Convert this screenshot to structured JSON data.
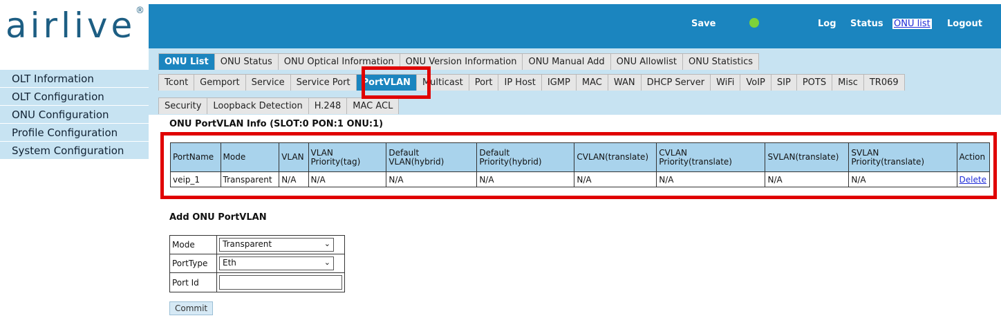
{
  "brand": {
    "logo_text": "airlive",
    "logo_mark": "®"
  },
  "header": {
    "save": "Save",
    "log": "Log",
    "status": "Status",
    "onu_list": "ONU list",
    "logout": "Logout",
    "status_led_color": "#7dd23a"
  },
  "sidebar": {
    "items": [
      {
        "label": "OLT Information"
      },
      {
        "label": "OLT Configuration"
      },
      {
        "label": "ONU Configuration"
      },
      {
        "label": "Profile Configuration"
      },
      {
        "label": "System Configuration"
      }
    ]
  },
  "tabs_row1": [
    "ONU List",
    "ONU Status",
    "ONU Optical Information",
    "ONU Version Information",
    "ONU Manual Add",
    "ONU Allowlist",
    "ONU Statistics"
  ],
  "tabs_row2": [
    "Tcont",
    "Gemport",
    "Service",
    "Service Port",
    "PortVLAN",
    "Multicast",
    "Port",
    "IP Host",
    "IGMP",
    "MAC",
    "WAN",
    "DHCP Server",
    "WiFi",
    "VoIP",
    "SIP",
    "POTS",
    "Misc",
    "TR069"
  ],
  "tabs_row3": [
    "Security",
    "Loopback Detection",
    "H.248",
    "MAC ACL"
  ],
  "info": {
    "title": "ONU PortVLAN Info (SLOT:0 PON:1 ONU:1)",
    "columns": [
      "PortName",
      "Mode",
      "VLAN",
      "VLAN Priority(tag)",
      "Default VLAN(hybrid)",
      "Default Priority(hybrid)",
      "CVLAN(translate)",
      "CVLAN Priority(translate)",
      "SVLAN(translate)",
      "SVLAN Priority(translate)",
      "Action"
    ],
    "rows": [
      [
        "veip_1",
        "Transparent",
        "N/A",
        "N/A",
        "N/A",
        "N/A",
        "N/A",
        "N/A",
        "N/A",
        "N/A",
        "Delete"
      ]
    ]
  },
  "add_form": {
    "title": "Add ONU PortVLAN",
    "mode_label": "Mode",
    "mode_value": "Transparent",
    "porttype_label": "PortType",
    "porttype_value": "Eth",
    "portid_label": "Port Id",
    "portid_value": "",
    "commit": "Commit"
  },
  "colors": {
    "brand_blue": "#1b85bf",
    "light_blue": "#c7e3f2",
    "highlight_red": "#e00000"
  }
}
